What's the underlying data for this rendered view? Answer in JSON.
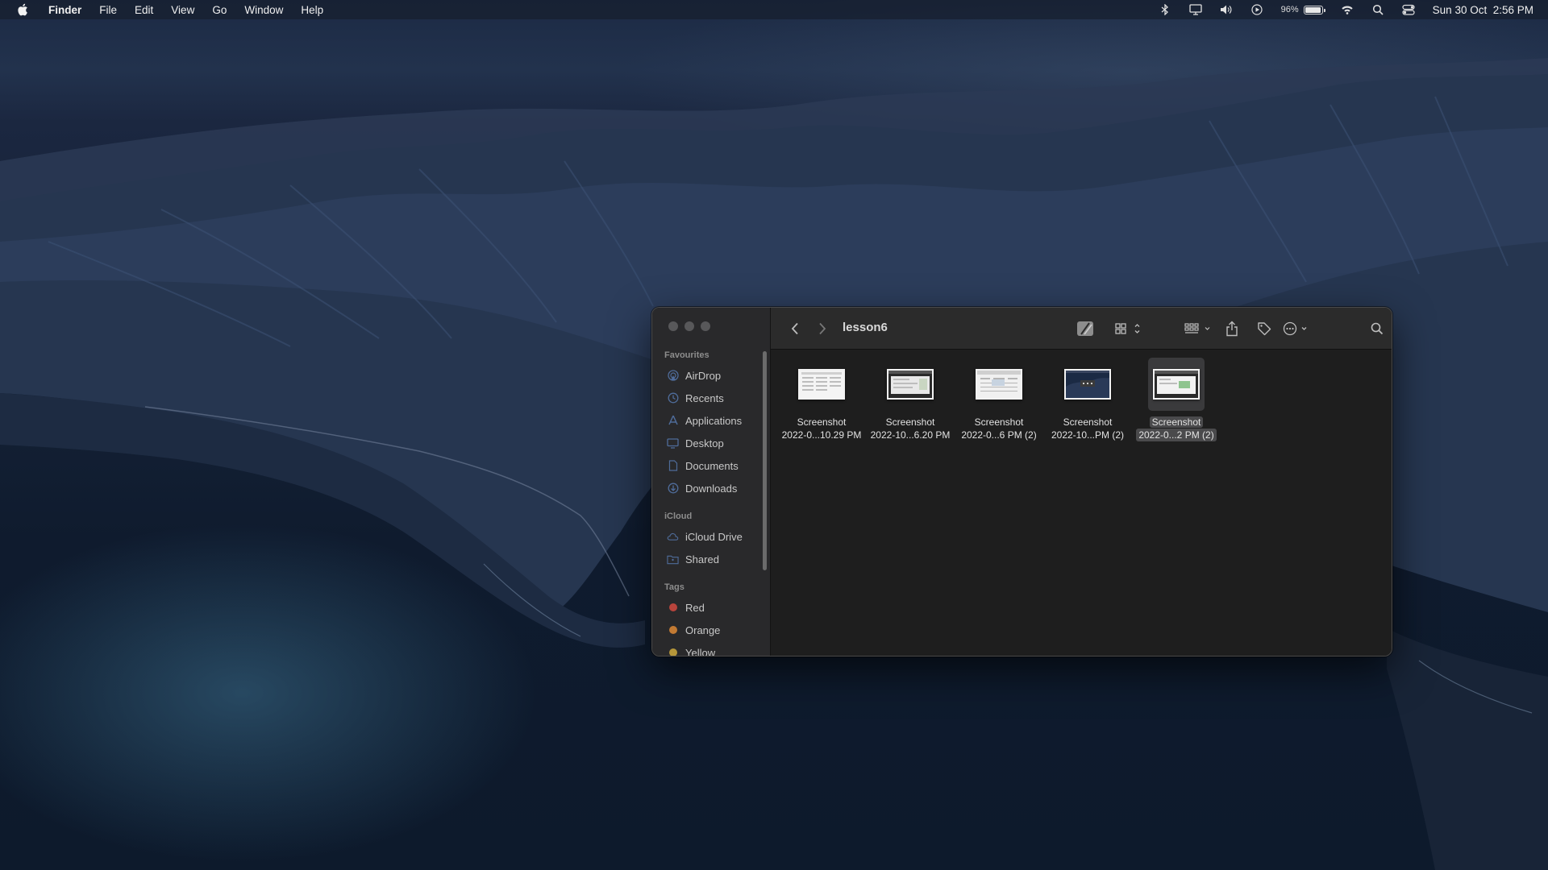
{
  "menubar": {
    "app_name": "Finder",
    "menus": [
      "File",
      "Edit",
      "View",
      "Go",
      "Window",
      "Help"
    ],
    "battery_percent": "96%",
    "clock": "Sun 30 Oct  2:56 PM",
    "status_icons": [
      "bluetooth-icon",
      "display-icon",
      "volume-icon",
      "play-icon",
      "battery-icon",
      "wifi-icon",
      "spotlight-icon",
      "control-center-icon"
    ]
  },
  "finder": {
    "title": "lesson6",
    "sidebar": {
      "favourites_title": "Favourites",
      "favourites": [
        {
          "label": "AirDrop",
          "icon": "airdrop-icon"
        },
        {
          "label": "Recents",
          "icon": "clock-icon"
        },
        {
          "label": "Applications",
          "icon": "applications-icon"
        },
        {
          "label": "Desktop",
          "icon": "desktop-icon"
        },
        {
          "label": "Documents",
          "icon": "document-icon"
        },
        {
          "label": "Downloads",
          "icon": "download-icon"
        }
      ],
      "icloud_title": "iCloud",
      "icloud": [
        {
          "label": "iCloud Drive",
          "icon": "cloud-icon"
        },
        {
          "label": "Shared",
          "icon": "shared-folder-icon"
        }
      ],
      "tags_title": "Tags",
      "tags": [
        {
          "label": "Red",
          "color": "#e0544a"
        },
        {
          "label": "Orange",
          "color": "#e9923a"
        },
        {
          "label": "Yellow",
          "color": "#d6b33c"
        }
      ]
    },
    "files": [
      {
        "line1": "Screenshot",
        "line2": "2022-0...10.29 PM",
        "selected": false
      },
      {
        "line1": "Screenshot",
        "line2": "2022-10...6.20 PM",
        "selected": false
      },
      {
        "line1": "Screenshot",
        "line2": "2022-0...6 PM (2)",
        "selected": false
      },
      {
        "line1": "Screenshot",
        "line2": "2022-10...PM (2)",
        "selected": false
      },
      {
        "line1": "Screenshot",
        "line2": "2022-0...2 PM (2)",
        "selected": true
      }
    ]
  }
}
